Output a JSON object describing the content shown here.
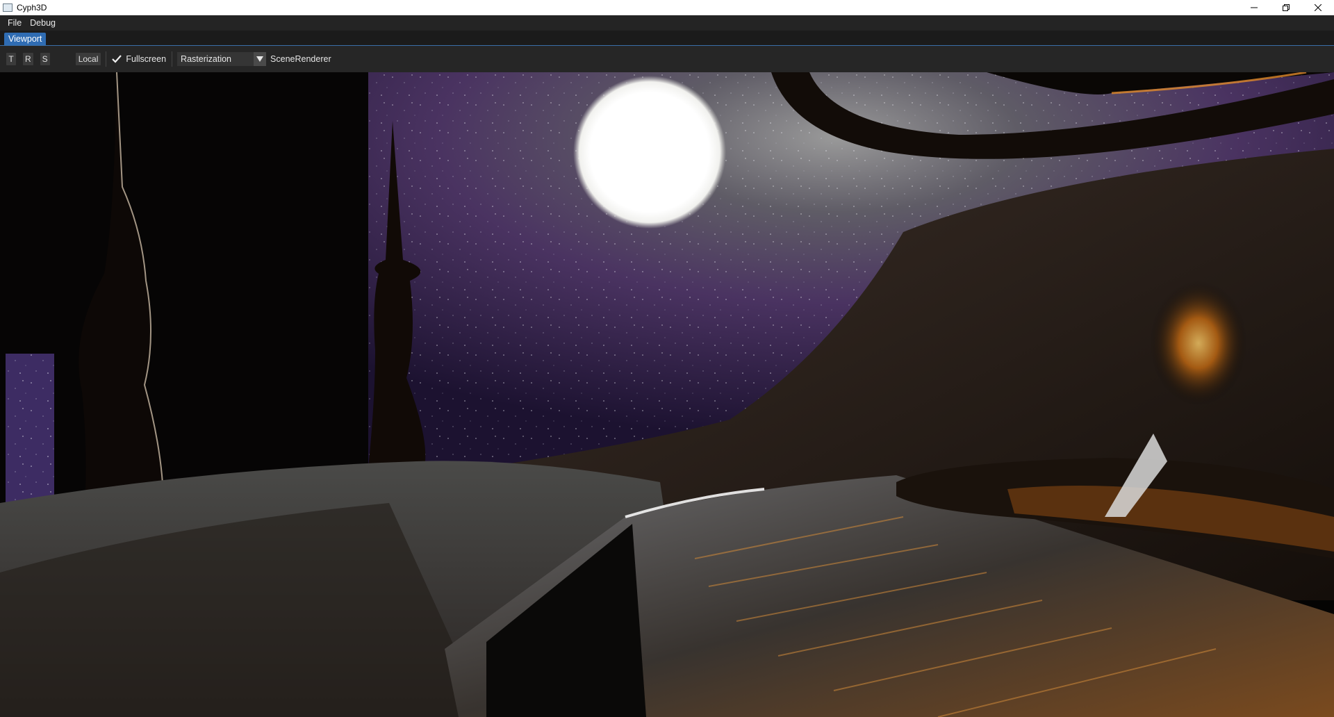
{
  "window": {
    "title": "Cyph3D",
    "controls": {
      "minimize_icon": "minimize-icon",
      "maximize_icon": "restore-icon",
      "close_icon": "close-icon"
    }
  },
  "menubar": {
    "items": [
      {
        "label": "File"
      },
      {
        "label": "Debug"
      }
    ]
  },
  "tabs": [
    {
      "label": "Viewport",
      "active": true
    }
  ],
  "toolbar": {
    "translate_label": "T",
    "rotate_label": "R",
    "scale_label": "S",
    "space_label": "Local",
    "fullscreen_label": "Fullscreen",
    "fullscreen_checked": true,
    "renderer_mode": "Rasterization",
    "renderer_label": "SceneRenderer"
  },
  "colors": {
    "accent": "#2f6cb3",
    "titlebar_bg": "#ffffff",
    "menubar_bg": "#242424",
    "toolbar_bg": "#262626"
  }
}
